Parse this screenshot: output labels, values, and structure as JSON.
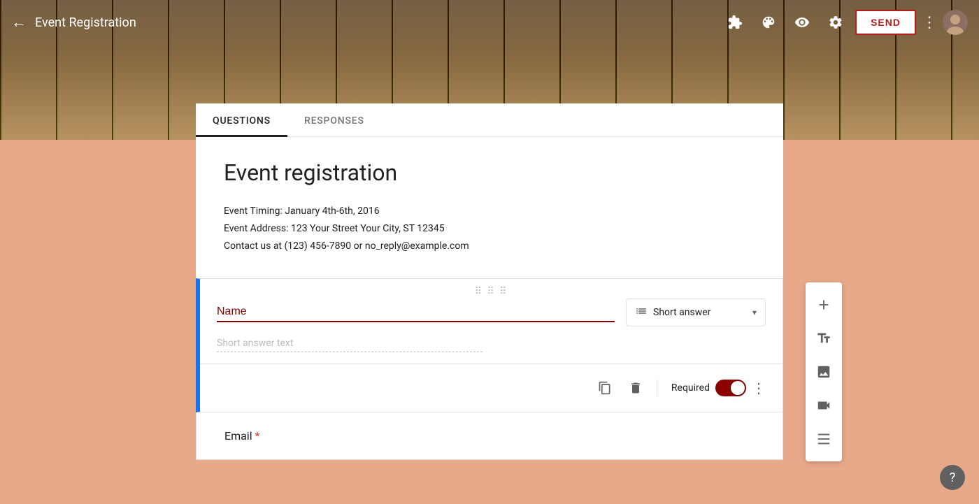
{
  "header": {
    "title": "Event Registration",
    "back_label": "←",
    "send_label": "SEND"
  },
  "tabs": [
    {
      "label": "QUESTIONS",
      "active": true
    },
    {
      "label": "RESPONSES",
      "active": false
    }
  ],
  "form": {
    "title": "Event registration",
    "description_line1": "Event Timing: January 4th-6th, 2016",
    "description_line2": "Event Address: 123 Your Street Your City, ST 12345",
    "description_line3": "Contact us at (123) 456-7890 or no_reply@example.com"
  },
  "question_card": {
    "drag_dots": "⠿",
    "question_value": "Name",
    "question_type_label": "Short answer",
    "answer_placeholder": "Short answer text",
    "required_label": "Required",
    "footer_more_dots": "⋮"
  },
  "email_card": {
    "label": "Email",
    "required_asterisk": "*"
  },
  "toolbar": {
    "add_icon": "+",
    "text_icon": "Tt",
    "image_icon": "🖼",
    "video_icon": "▶",
    "section_icon": "▬"
  },
  "icons": {
    "back": "←",
    "puzzle": "⚙",
    "palette": "🎨",
    "eye": "👁",
    "settings": "⚙",
    "more_vert": "⋮",
    "copy": "⧉",
    "delete": "🗑",
    "drag": "⠿⠿",
    "question_type_icon": "≡",
    "chevron_down": "▾",
    "help": "?"
  },
  "colors": {
    "accent": "#8b0000",
    "blue_border": "#1a73e8",
    "bg_peach": "#e8a98a",
    "tab_active_border": "#212121"
  }
}
